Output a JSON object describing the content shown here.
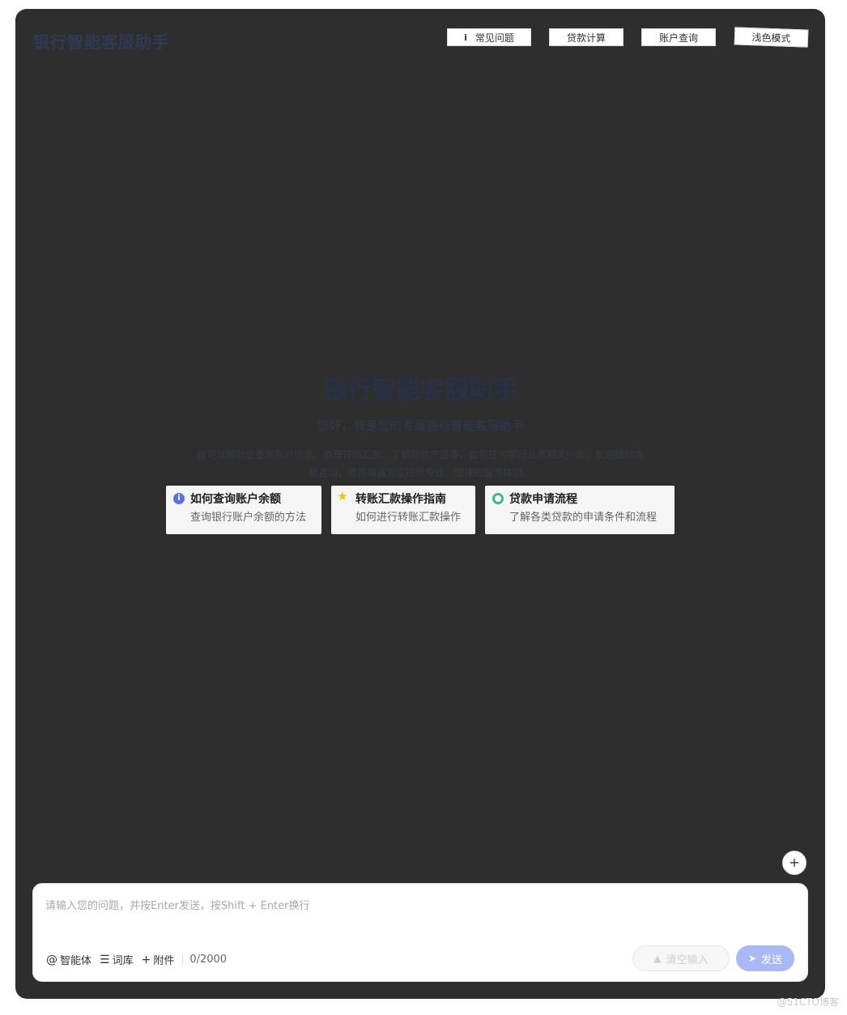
{
  "header": {
    "title": "银行智能客服助手",
    "buttons": {
      "faq": "常见问题",
      "loan_calc": "贷款计算",
      "account_query": "账户查询",
      "theme": "浅色模式"
    }
  },
  "hero": {
    "title": "银行智能客服助手",
    "subtitle": "您好，我是您的专属银行智能客服助手",
    "description": "我可以帮助您查询账户信息、办理转账汇款、了解贷款产品等，如有任何银行业务相关问题，欢迎随时向我咨询，我将竭诚为您提供专业、便捷的服务体验。"
  },
  "suggestions": [
    {
      "icon": "info-icon",
      "title": "如何查询账户余额",
      "desc": "查询银行账户余额的方法"
    },
    {
      "icon": "star-icon",
      "title": "转账汇款操作指南",
      "desc": "如何进行转账汇款操作"
    },
    {
      "icon": "circle-icon",
      "title": "贷款申请流程",
      "desc": "了解各类贷款的申请条件和流程"
    }
  ],
  "composer": {
    "placeholder": "请输入您的问题，并按Enter发送，按Shift + Enter换行",
    "tools": {
      "agent": "智能体",
      "lexicon": "词库",
      "attachment": "附件"
    },
    "counter": "0/2000",
    "clear_label": "清空输入",
    "send_label": "发送"
  },
  "watermark": "@51CTO博客",
  "colors": {
    "background": "#2e2e2e",
    "send_button": "#aab8f5",
    "accent_blue": "#5b72d6",
    "accent_green": "#3bb98a",
    "accent_yellow": "#f5c400"
  }
}
